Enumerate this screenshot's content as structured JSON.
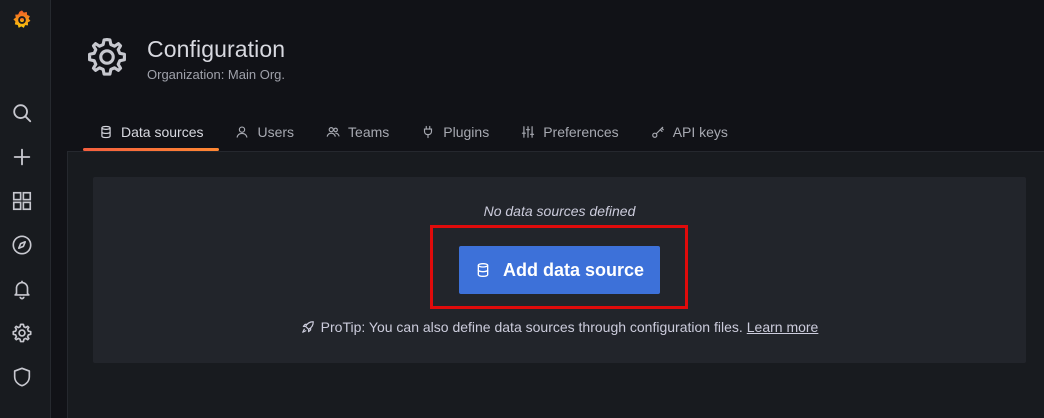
{
  "sidebar": {
    "icons": [
      {
        "name": "grafana-logo-icon"
      },
      {
        "name": "search-icon"
      },
      {
        "name": "plus-icon"
      },
      {
        "name": "dashboards-grid-icon"
      },
      {
        "name": "explore-compass-icon"
      },
      {
        "name": "alerting-bell-icon"
      },
      {
        "name": "configuration-gear-icon"
      },
      {
        "name": "server-admin-shield-icon"
      }
    ]
  },
  "header": {
    "title": "Configuration",
    "subtitle": "Organization: Main Org.",
    "icon": "gear-icon"
  },
  "tabs": [
    {
      "label": "Data sources",
      "icon": "database-icon",
      "active": true
    },
    {
      "label": "Users",
      "icon": "user-icon",
      "active": false
    },
    {
      "label": "Teams",
      "icon": "users-icon",
      "active": false
    },
    {
      "label": "Plugins",
      "icon": "plug-icon",
      "active": false
    },
    {
      "label": "Preferences",
      "icon": "sliders-icon",
      "active": false
    },
    {
      "label": "API keys",
      "icon": "key-icon",
      "active": false
    }
  ],
  "empty_state": {
    "title": "No data sources defined",
    "button_label": "Add data source",
    "protip_text": "ProTip: You can also define data sources through configuration files.",
    "protip_link": "Learn more"
  },
  "colors": {
    "accent_blue": "#3d71d9",
    "highlight_red": "#e00b0b",
    "tab_active_gradient_start": "#f55f3e",
    "tab_active_gradient_end": "#ff8833"
  }
}
